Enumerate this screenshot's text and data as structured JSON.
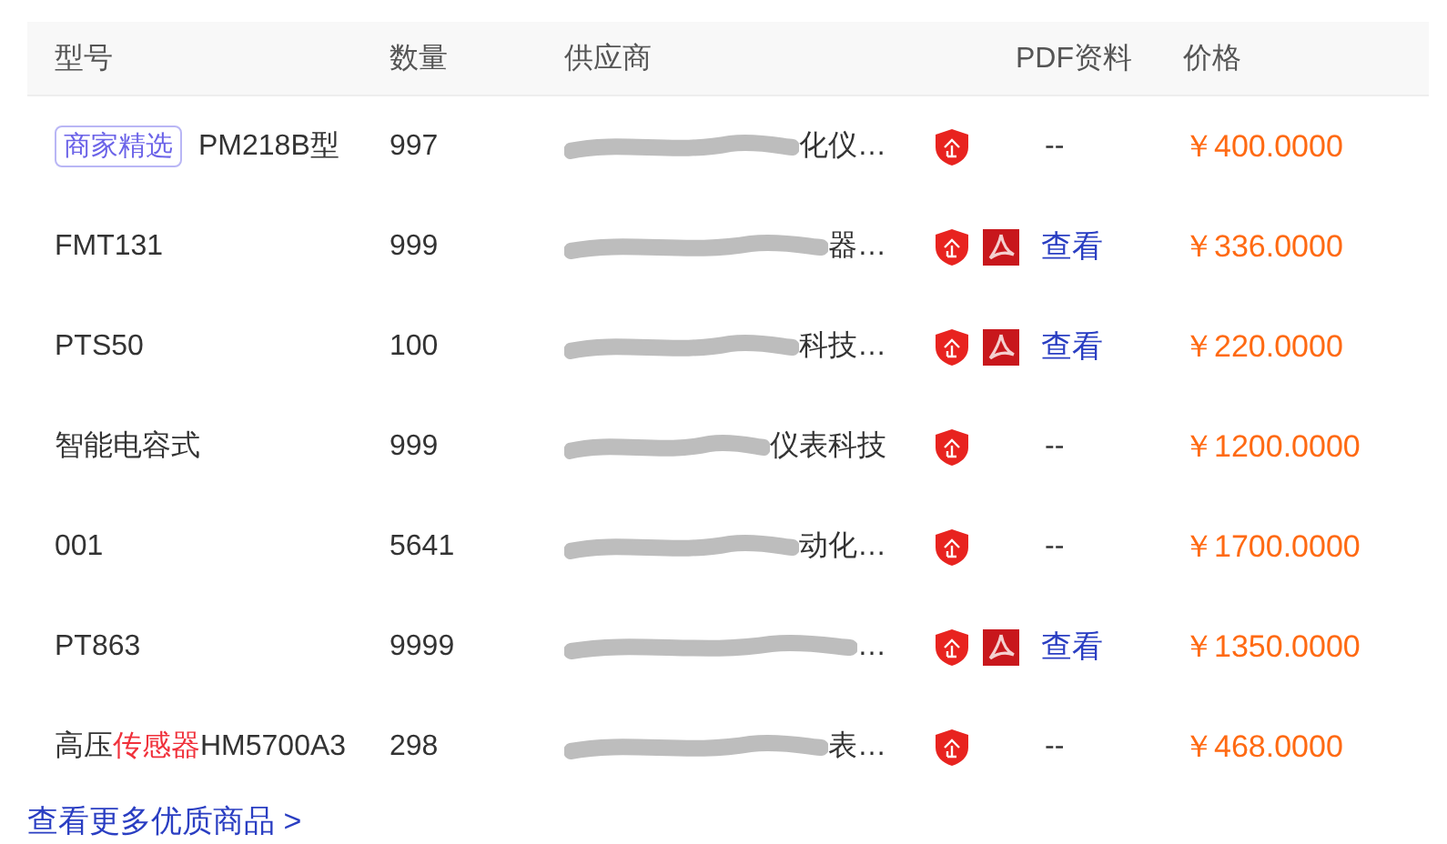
{
  "table": {
    "columns": [
      "型号",
      "数量",
      "供应商",
      "PDF资料",
      "价格"
    ],
    "rows": [
      {
        "featured_tag": "商家精选",
        "model": [
          {
            "text": "PM218B型",
            "highlight": false
          }
        ],
        "quantity": "997",
        "supplier": "化仪…",
        "redacted": true,
        "verified": true,
        "pdf": null,
        "price": "￥400.0000"
      },
      {
        "model": [
          {
            "text": "FMT131",
            "highlight": false
          }
        ],
        "quantity": "999",
        "supplier": "器…",
        "redacted": true,
        "verified": true,
        "pdf": "查看",
        "price": "￥336.0000"
      },
      {
        "model": [
          {
            "text": "PTS50",
            "highlight": false
          }
        ],
        "quantity": "100",
        "supplier": "科技…",
        "redacted": true,
        "verified": true,
        "pdf": "查看",
        "price": "￥220.0000"
      },
      {
        "model": [
          {
            "text": "智能电容式",
            "highlight": false
          }
        ],
        "quantity": "999",
        "supplier": "仪表科技",
        "redacted": true,
        "verified": true,
        "pdf": null,
        "price": "￥1200.0000"
      },
      {
        "model": [
          {
            "text": "001",
            "highlight": false
          }
        ],
        "quantity": "5641",
        "supplier": "动化…",
        "redacted": true,
        "verified": true,
        "pdf": null,
        "price": "￥1700.0000"
      },
      {
        "model": [
          {
            "text": "PT863",
            "highlight": false
          }
        ],
        "quantity": "9999",
        "supplier": "…",
        "redacted": true,
        "verified": true,
        "pdf": "查看",
        "price": "￥1350.0000"
      },
      {
        "model": [
          {
            "text": "高压",
            "highlight": false
          },
          {
            "text": "传感器",
            "highlight": true
          },
          {
            "text": "HM5700A3",
            "highlight": false
          }
        ],
        "quantity": "298",
        "supplier": "表…",
        "redacted": true,
        "verified": true,
        "pdf": null,
        "price": "￥468.0000"
      }
    ],
    "empty_cell": "--"
  },
  "more_link": "查看更多优质商品 >"
}
